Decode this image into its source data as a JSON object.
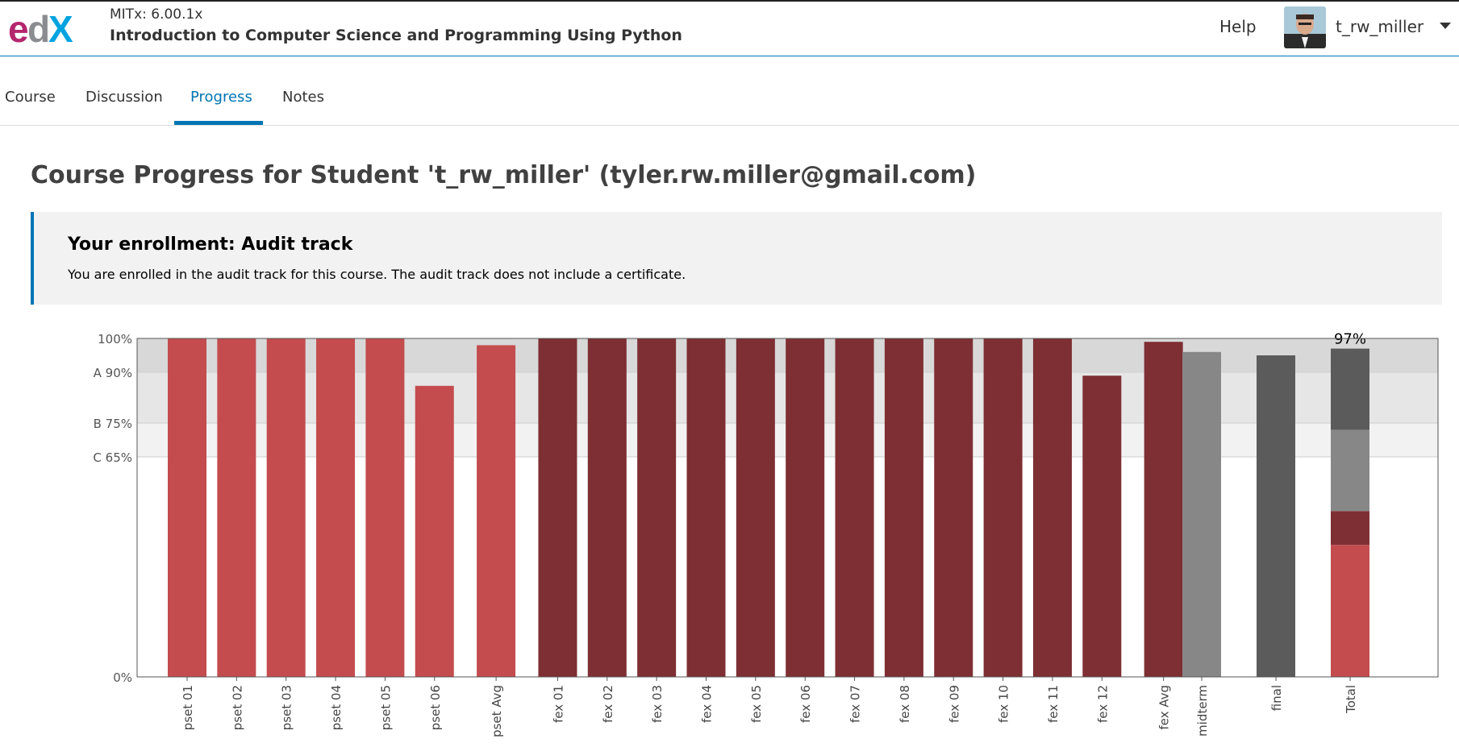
{
  "header": {
    "course_org": "MITx: 6.00.1x",
    "course_title": "Introduction to Computer Science and Programming Using Python",
    "help_label": "Help",
    "username": "t_rw_miller",
    "logo_icon": "edx-logo-icon",
    "avatar_icon": "user-avatar-icon",
    "caret_icon": "caret-down-icon"
  },
  "tabs": [
    {
      "label": "Course",
      "active": false
    },
    {
      "label": "Discussion",
      "active": false
    },
    {
      "label": "Progress",
      "active": true
    },
    {
      "label": "Notes",
      "active": false
    }
  ],
  "page_title": "Course Progress for Student 't_rw_miller' (tyler.rw.miller@gmail.com)",
  "enrollment": {
    "title": "Your enrollment: Audit track",
    "description": "You are enrolled in the audit track for this course. The audit track does not include a certificate."
  },
  "colors": {
    "accent": "#0075b4",
    "pset": "#c44c4e",
    "fex": "#7e2f33",
    "midterm": "#878787",
    "final": "#5b5b5b"
  },
  "chart_data": {
    "type": "bar",
    "categories": [
      "pset 01",
      "pset 02",
      "pset 03",
      "pset 04",
      "pset 05",
      "pset 06",
      "pset Avg",
      "fex 01",
      "fex 02",
      "fex 03",
      "fex 04",
      "fex 05",
      "fex 06",
      "fex 07",
      "fex 08",
      "fex 09",
      "fex 10",
      "fex 11",
      "fex 12",
      "fex Avg",
      "midterm",
      "final",
      "Total"
    ],
    "values": [
      100,
      100,
      100,
      100,
      100,
      86,
      98,
      100,
      100,
      100,
      100,
      100,
      100,
      100,
      100,
      100,
      100,
      100,
      89,
      99,
      96,
      95,
      97
    ],
    "groups": [
      "pset",
      "pset",
      "pset",
      "pset",
      "pset",
      "pset",
      "pset",
      "fex",
      "fex",
      "fex",
      "fex",
      "fex",
      "fex",
      "fex",
      "fex",
      "fex",
      "fex",
      "fex",
      "fex",
      "fex",
      "midterm",
      "final",
      "total"
    ],
    "total_stack": [
      {
        "group": "pset",
        "value": 39
      },
      {
        "group": "fex",
        "value": 10
      },
      {
        "group": "midterm",
        "value": 24
      },
      {
        "group": "final",
        "value": 24
      }
    ],
    "total_label": "97%",
    "yticks": [
      {
        "value": 100,
        "label": "100%"
      },
      {
        "value": 90,
        "label": "A 90%"
      },
      {
        "value": 75,
        "label": "B 75%"
      },
      {
        "value": 65,
        "label": "C 65%"
      },
      {
        "value": 0,
        "label": "0%"
      }
    ],
    "grade_bands": [
      {
        "from": 90,
        "to": 100,
        "color": "#d8d8d8"
      },
      {
        "from": 75,
        "to": 90,
        "color": "#e6e6e6"
      },
      {
        "from": 65,
        "to": 75,
        "color": "#f2f2f2"
      }
    ],
    "ylim": [
      0,
      100
    ]
  }
}
